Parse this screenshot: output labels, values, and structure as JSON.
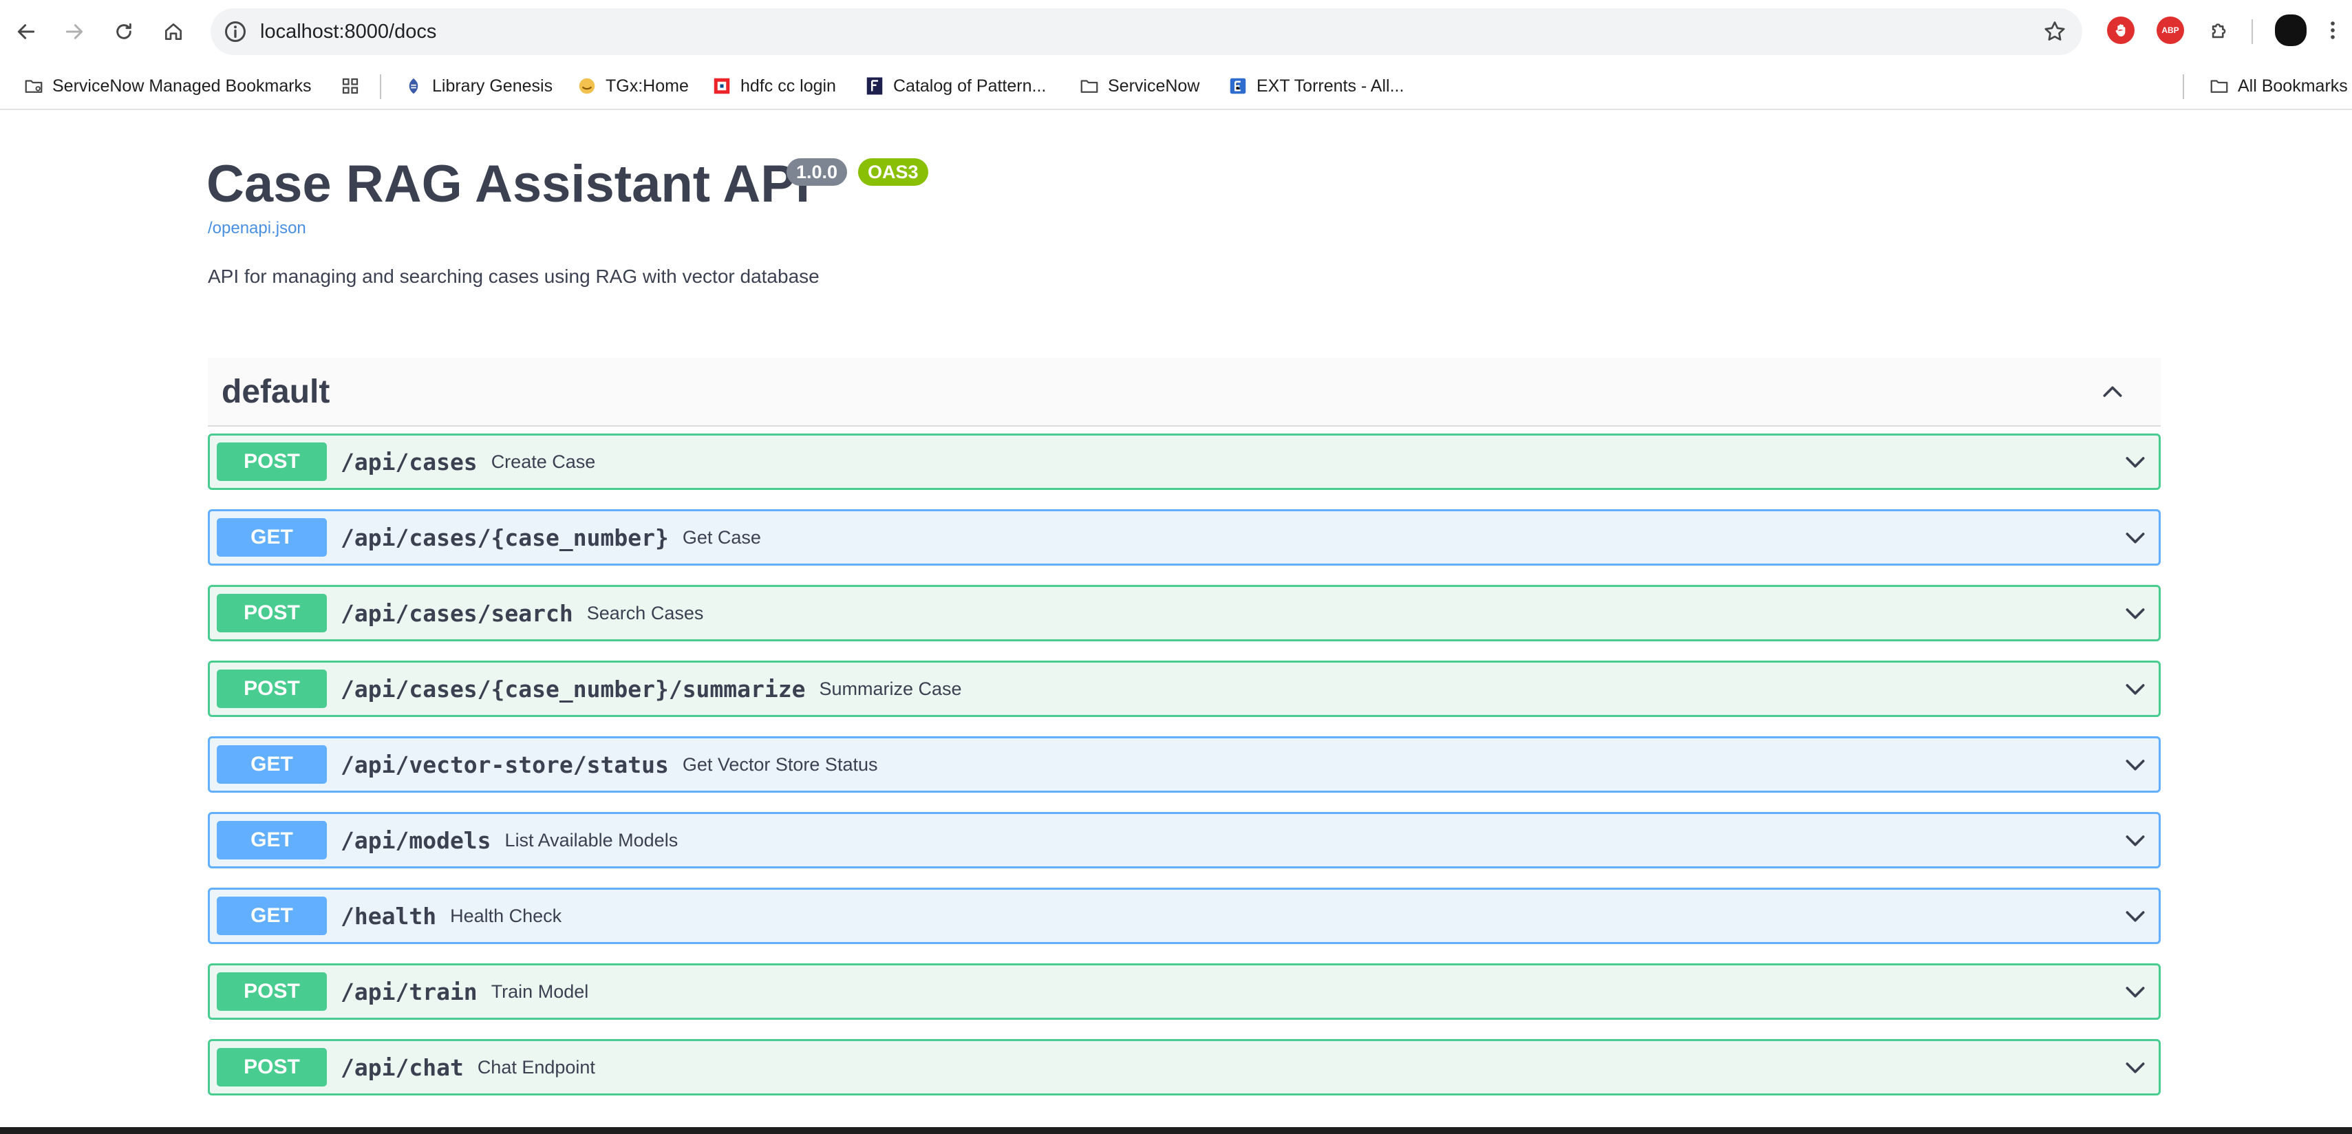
{
  "browser": {
    "url": "localhost:8000/docs",
    "extensions": [
      "abp-red-hand-icon",
      "adblock-plus-icon",
      "puzzle-extensions-icon"
    ],
    "bookmarks": [
      {
        "label": "ServiceNow Managed Bookmarks",
        "icon": "managed-folder-icon"
      },
      {
        "label": "",
        "icon": "apps-grid-icon"
      },
      {
        "label": "Library Genesis",
        "icon": "library-genesis-icon"
      },
      {
        "label": "TGx:Home",
        "icon": "tgx-icon"
      },
      {
        "label": "hdfc cc login",
        "icon": "hdfc-icon"
      },
      {
        "label": "Catalog of Pattern...",
        "icon": "f-logo-icon"
      },
      {
        "label": "ServiceNow",
        "icon": "folder-icon"
      },
      {
        "label": "EXT Torrents - All...",
        "icon": "ext-e-icon"
      }
    ],
    "all_bookmarks_label": "All Bookmarks"
  },
  "api": {
    "title": "Case RAG Assistant API",
    "version": "1.0.0",
    "oas": "OAS3",
    "spec_link": "/openapi.json",
    "description": "API for managing and searching cases using RAG with vector database"
  },
  "tag": {
    "name": "default",
    "expanded": true
  },
  "operations": [
    {
      "method": "POST",
      "path": "/api/cases",
      "summary": "Create Case"
    },
    {
      "method": "GET",
      "path": "/api/cases/{case_number}",
      "summary": "Get Case"
    },
    {
      "method": "POST",
      "path": "/api/cases/search",
      "summary": "Search Cases"
    },
    {
      "method": "POST",
      "path": "/api/cases/{case_number}/summarize",
      "summary": "Summarize Case"
    },
    {
      "method": "GET",
      "path": "/api/vector-store/status",
      "summary": "Get Vector Store Status"
    },
    {
      "method": "GET",
      "path": "/api/models",
      "summary": "List Available Models"
    },
    {
      "method": "GET",
      "path": "/health",
      "summary": "Health Check"
    },
    {
      "method": "POST",
      "path": "/api/train",
      "summary": "Train Model"
    },
    {
      "method": "POST",
      "path": "/api/chat",
      "summary": "Chat Endpoint"
    }
  ],
  "colors": {
    "post": "#49cc90",
    "get": "#61affe",
    "version_badge": "#7d8492",
    "oas_badge": "#89bf04"
  }
}
